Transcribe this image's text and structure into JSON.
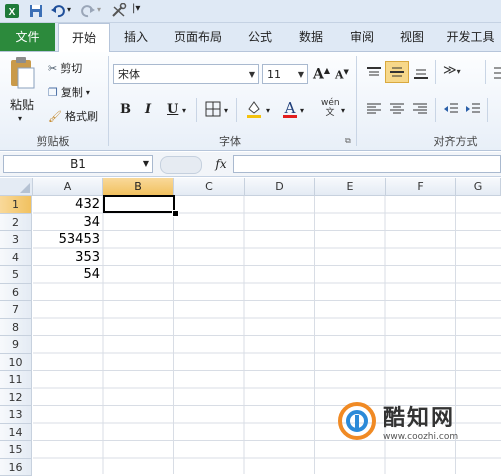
{
  "quick_access": {
    "icons": [
      "excel-icon",
      "save-icon",
      "undo-icon",
      "redo-icon",
      "customize-icon"
    ]
  },
  "tabs": [
    "文件",
    "开始",
    "插入",
    "页面布局",
    "公式",
    "数据",
    "审阅",
    "视图",
    "开发工具"
  ],
  "ribbon": {
    "clipboard": {
      "paste": "粘贴",
      "cut": "剪切",
      "copy": "复制",
      "format_painter": "格式刷",
      "group_label": "剪贴板"
    },
    "font": {
      "font_name": "宋体",
      "font_size": "11",
      "bold": "B",
      "italic": "I",
      "underline": "U",
      "grow": "A",
      "shrink": "A",
      "group_label": "字体"
    },
    "alignment": {
      "group_label": "对齐方式"
    }
  },
  "formula_bar": {
    "name_box": "B1",
    "fx": "fx",
    "formula": ""
  },
  "grid": {
    "columns": [
      "A",
      "B",
      "C",
      "D",
      "E",
      "F",
      "G"
    ],
    "rows": [
      "1",
      "2",
      "3",
      "4",
      "5",
      "6",
      "7",
      "8",
      "9",
      "10",
      "11",
      "12",
      "13",
      "14",
      "15",
      "16"
    ],
    "column_a_values": [
      "432",
      "34",
      "53453",
      "353",
      "54"
    ],
    "selected_column": "B",
    "selected_row": "1"
  },
  "watermark": {
    "name": "酷知网",
    "url": "www.coozhi.com"
  },
  "colors": {
    "file_tab": "#2c8a3c",
    "selection_header": "#f1c15f"
  }
}
